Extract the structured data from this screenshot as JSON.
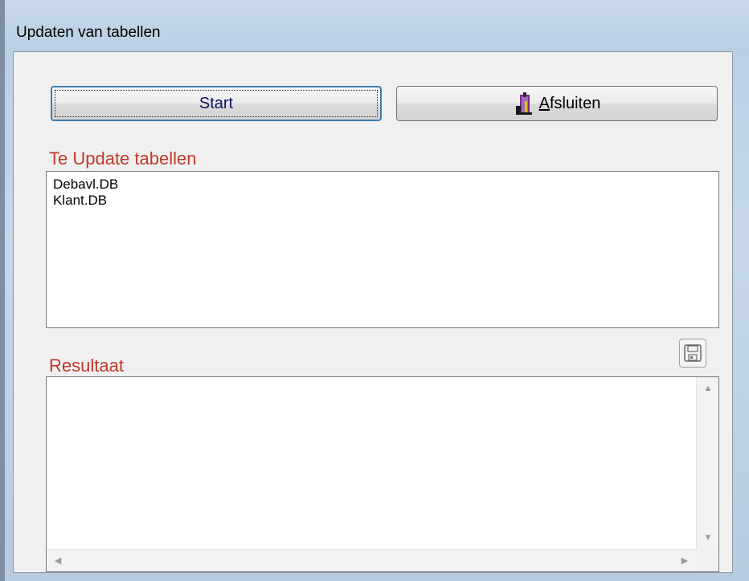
{
  "window": {
    "title": "Updaten van tabellen"
  },
  "buttons": {
    "start_label": "Start",
    "close_label_accel": "A",
    "close_label_rest": "fsluiten"
  },
  "tables": {
    "label": "Te Update tabellen",
    "items": [
      "Debavl.DB",
      "Klant.DB"
    ]
  },
  "result": {
    "label": "Resultaat",
    "text": ""
  },
  "colors": {
    "section_label": "#c0392b",
    "start_text": "#10106a",
    "focus_border": "#3c7fb1"
  },
  "icons": {
    "close": "exit-door-icon",
    "save": "floppy-disk-icon"
  }
}
